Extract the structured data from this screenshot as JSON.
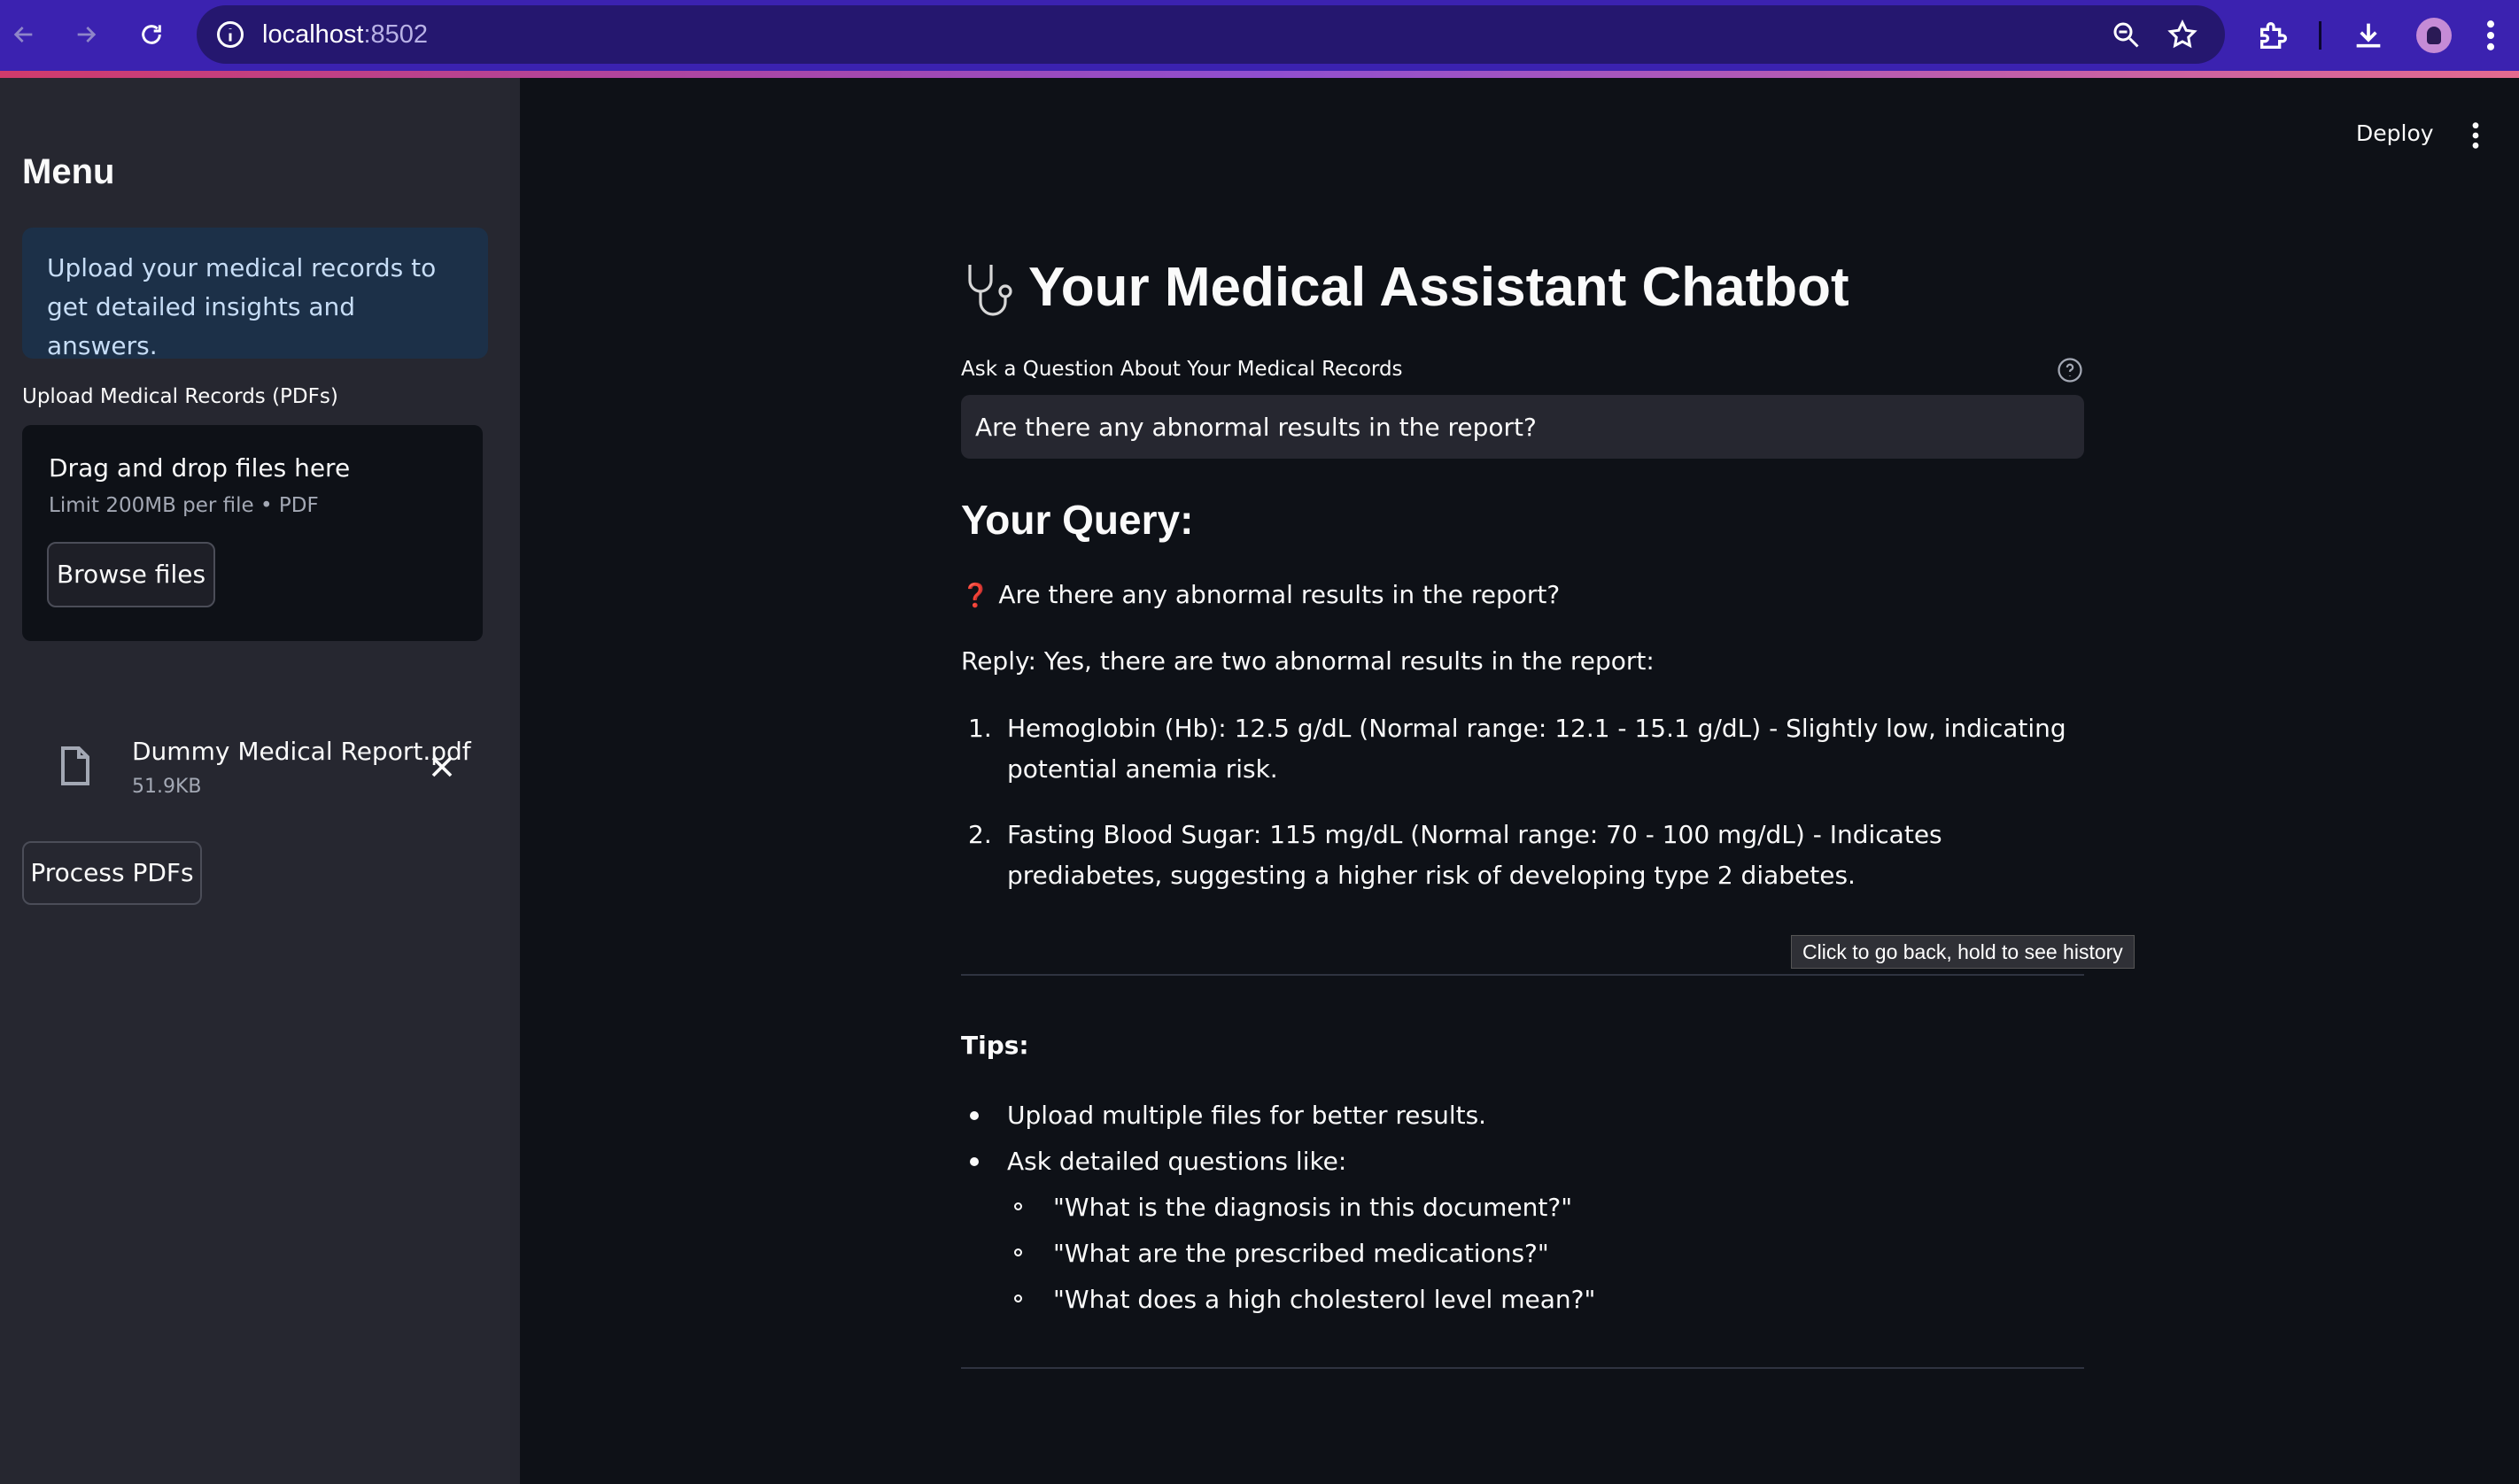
{
  "browser": {
    "url_host": "localhost",
    "url_port": ":8502"
  },
  "sidebar": {
    "menu_title": "Menu",
    "info_text": "Upload your medical records to get detailed insights and answers.",
    "upload_label": "Upload Medical Records (PDFs)",
    "dropzone_title": "Drag and drop files here",
    "dropzone_limit": "Limit 200MB per file • PDF",
    "browse_label": "Browse files",
    "file": {
      "name": "Dummy Medical Report.pdf",
      "size": "51.9KB"
    },
    "process_label": "Process PDFs"
  },
  "header": {
    "deploy_label": "Deploy"
  },
  "main": {
    "title": "Your Medical Assistant Chatbot",
    "question_label": "Ask a Question About Your Medical Records",
    "question_value": "Are there any abnormal results in the report?",
    "query_heading": "Your Query:",
    "query_mark": "❓",
    "query_text": "Are there any abnormal results in the report?",
    "reply_intro": "Reply: Yes, there are two abnormal results in the report:",
    "reply_items": [
      {
        "num": "1.",
        "text": "Hemoglobin (Hb): 12.5 g/dL (Normal range: 12.1 - 15.1 g/dL) - Slightly low, indicating potential anemia risk."
      },
      {
        "num": "2.",
        "text": "Fasting Blood Sugar: 115 mg/dL (Normal range: 70 - 100 mg/dL) - Indicates prediabetes, suggesting a higher risk of developing type 2 diabetes."
      }
    ],
    "tooltip": "Click to go back, hold to see history",
    "tips_heading": "Tips:",
    "tips": [
      "Upload multiple files for better results.",
      "Ask detailed questions like:"
    ],
    "tips_sub": [
      "\"What is the diagnosis in this document?\"",
      "\"What are the prescribed medications?\"",
      "\"What does a high cholesterol level mean?\""
    ]
  },
  "icons": {
    "back": "arrow-left-icon",
    "forward": "arrow-right-icon",
    "reload": "reload-icon",
    "info": "site-info-icon",
    "zoom": "zoom-icon",
    "bookmark": "star-icon",
    "extensions": "puzzle-icon",
    "download": "download-icon",
    "profile": "avatar",
    "menu": "kebab-icon",
    "stethoscope": "stethoscope-icon",
    "file": "file-icon",
    "remove": "close-icon",
    "help": "help-icon"
  },
  "colors": {
    "background": "#0e1117",
    "sidebar": "#262730",
    "info_box": "#1c3048",
    "accent": "#e0323e",
    "browser_frame": "#3b22b0"
  }
}
